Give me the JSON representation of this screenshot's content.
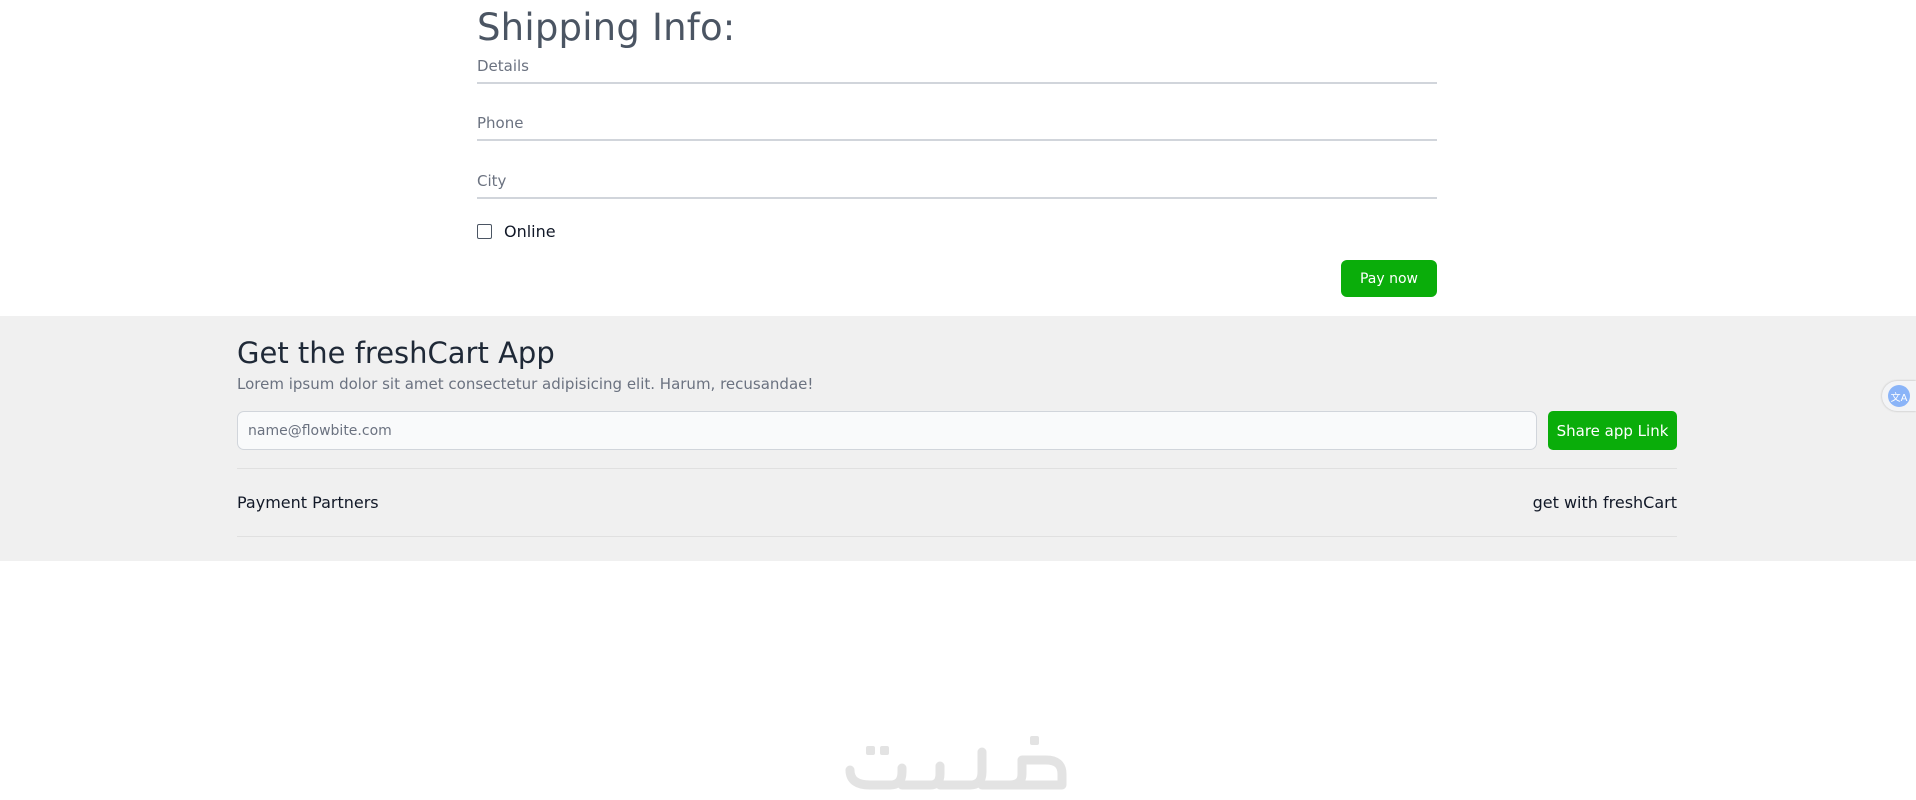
{
  "shipping": {
    "title": "Shipping Info:",
    "details_placeholder": "Details",
    "phone_placeholder": "Phone",
    "city_placeholder": "City",
    "online_label": "Online",
    "online_checked": false,
    "pay_button_label": "Pay now"
  },
  "app_section": {
    "title": "Get the freshCart App",
    "subtitle": "Lorem ipsum dolor sit amet consectetur adipisicing elit. Harum, recusandae!",
    "email_placeholder": "name@flowbite.com",
    "share_button_label": "Share app Link",
    "payment_partners_label": "Payment Partners",
    "get_with_label": "get with freshCart"
  },
  "widgets": {
    "translate_icon": "translate-icon",
    "translate_glyph": "文A",
    "watermark_logo": "khamsat-logo",
    "watermark_text": "خمسات"
  },
  "colors": {
    "accent_green": "#0aad0a",
    "footer_background": "#f0f0f0",
    "title_gray": "#4b5563"
  }
}
